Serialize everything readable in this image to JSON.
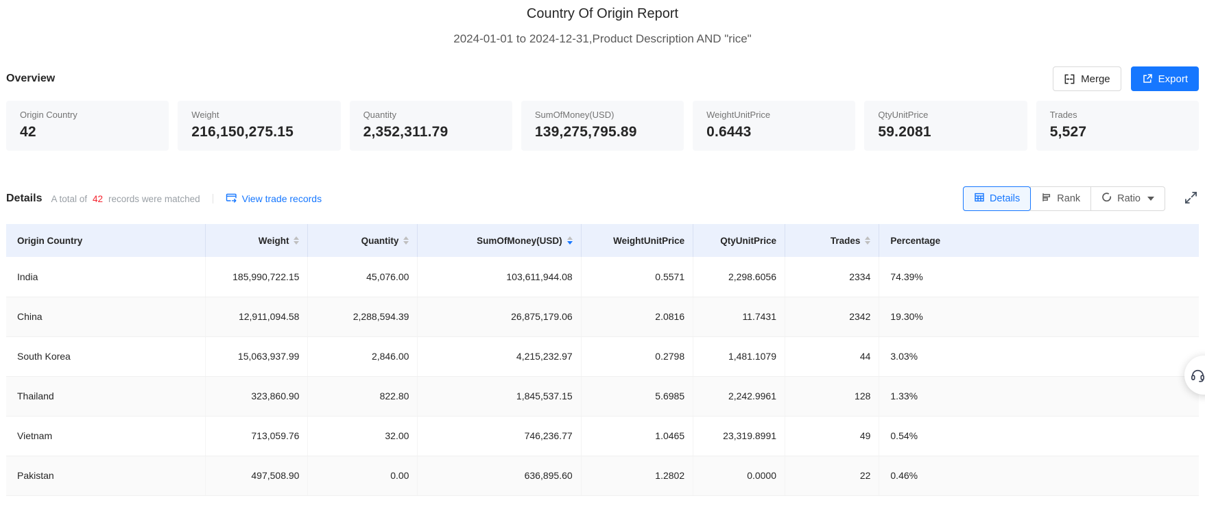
{
  "page": {
    "title": "Country Of Origin Report",
    "subtitle": "2024-01-01 to 2024-12-31,Product Description AND \"rice\""
  },
  "toolbar": {
    "merge_label": "Merge",
    "export_label": "Export"
  },
  "overview": {
    "heading": "Overview",
    "cards": [
      {
        "label": "Origin Country",
        "value": "42"
      },
      {
        "label": "Weight",
        "value": "216,150,275.15"
      },
      {
        "label": "Quantity",
        "value": "2,352,311.79"
      },
      {
        "label": "SumOfMoney(USD)",
        "value": "139,275,795.89"
      },
      {
        "label": "WeightUnitPrice",
        "value": "0.6443"
      },
      {
        "label": "QtyUnitPrice",
        "value": "59.2081"
      },
      {
        "label": "Trades",
        "value": "5,527"
      }
    ]
  },
  "details": {
    "heading": "Details",
    "match_prefix": "A total of",
    "match_count": "42",
    "match_suffix": "records were matched",
    "view_link_label": "View trade records",
    "view_tabs": {
      "details": "Details",
      "rank": "Rank",
      "ratio": "Ratio"
    }
  },
  "table": {
    "columns": [
      {
        "label": "Origin Country",
        "sortable": false,
        "align": "left"
      },
      {
        "label": "Weight",
        "sortable": true,
        "align": "right"
      },
      {
        "label": "Quantity",
        "sortable": true,
        "align": "right"
      },
      {
        "label": "SumOfMoney(USD)",
        "sortable": true,
        "align": "right",
        "sorted": "desc"
      },
      {
        "label": "WeightUnitPrice",
        "sortable": false,
        "align": "right"
      },
      {
        "label": "QtyUnitPrice",
        "sortable": false,
        "align": "right"
      },
      {
        "label": "Trades",
        "sortable": true,
        "align": "right"
      },
      {
        "label": "Percentage",
        "sortable": false,
        "align": "left"
      }
    ],
    "rows": [
      [
        "India",
        "185,990,722.15",
        "45,076.00",
        "103,611,944.08",
        "0.5571",
        "2,298.6056",
        "2334",
        "74.39%"
      ],
      [
        "China",
        "12,911,094.58",
        "2,288,594.39",
        "26,875,179.06",
        "2.0816",
        "11.7431",
        "2342",
        "19.30%"
      ],
      [
        "South Korea",
        "15,063,937.99",
        "2,846.00",
        "4,215,232.97",
        "0.2798",
        "1,481.1079",
        "44",
        "3.03%"
      ],
      [
        "Thailand",
        "323,860.90",
        "822.80",
        "1,845,537.15",
        "5.6985",
        "2,242.9961",
        "128",
        "1.33%"
      ],
      [
        "Vietnam",
        "713,059.76",
        "32.00",
        "746,236.77",
        "1.0465",
        "23,319.8991",
        "49",
        "0.54%"
      ],
      [
        "Pakistan",
        "497,508.90",
        "0.00",
        "636,895.60",
        "1.2802",
        "0.0000",
        "22",
        "0.46%"
      ]
    ]
  },
  "icons": {
    "merge": "merge-cells-icon",
    "export": "export-icon",
    "view_trade": "window-arrow-icon",
    "details_tab": "table-grid-icon",
    "rank_tab": "bar-rank-icon",
    "ratio_tab": "circle-ratio-icon",
    "fullscreen": "fullscreen-expand-icon",
    "support": "headset-icon",
    "sort": "caret-sort-icon"
  },
  "colors": {
    "accent_blue": "#1677ff",
    "count_red": "#f5222d",
    "table_header_bg": "#ebf1fd",
    "card_bg": "#f7f8fa",
    "row_alt_bg": "#fafafa"
  }
}
